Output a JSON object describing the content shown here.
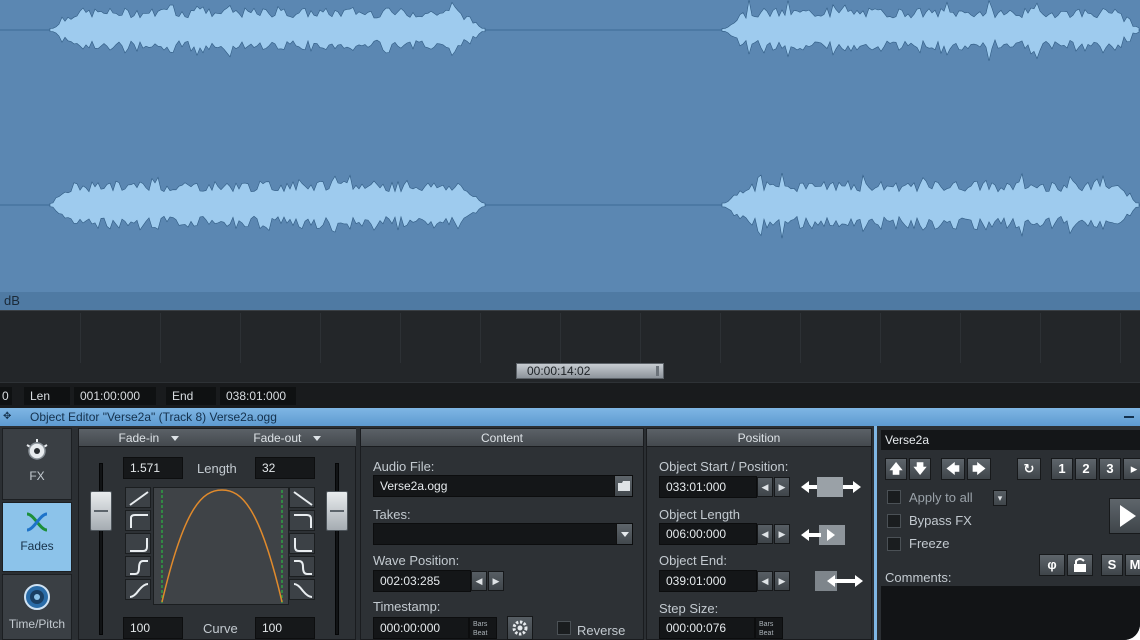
{
  "status": {
    "db_label": "dB",
    "timeline_position": "00:00:14:02"
  },
  "posbar": {
    "partial_value": "0",
    "len_label": "Len",
    "len_value": "001:00:000",
    "end_label": "End",
    "end_value": "038:01:000"
  },
  "object_editor": {
    "title": "Object Editor \"Verse2a\"  (Track 8)  Verse2a.ogg"
  },
  "nav": {
    "fx": "FX",
    "fades": "Fades",
    "time_pitch": "Time/Pitch"
  },
  "fades": {
    "fade_in_label": "Fade-in",
    "fade_out_label": "Fade-out",
    "fade_in_value": "1.571",
    "length_label": "Length",
    "length_value": "32",
    "curve_label": "Curve",
    "curve_in_value": "100",
    "curve_out_value": "100"
  },
  "content": {
    "header": "Content",
    "audio_file_label": "Audio File:",
    "audio_file_value": "Verse2a.ogg",
    "takes_label": "Takes:",
    "takes_value": "",
    "wave_position_label": "Wave Position:",
    "wave_position_value": "002:03:285",
    "timestamp_label": "Timestamp:",
    "timestamp_value": "000:00:000",
    "unit_bars": "Bars",
    "unit_beat": "Beat",
    "reverse_label": "Reverse"
  },
  "position": {
    "header": "Position",
    "start_label": "Object Start / Position:",
    "start_value": "033:01:000",
    "length_label": "Object Length",
    "length_value": "006:00:000",
    "end_label": "Object End:",
    "end_value": "039:01:000",
    "step_label": "Step Size:",
    "step_value": "000:00:076",
    "unit_bars": "Bars",
    "unit_beat": "Beat"
  },
  "right": {
    "object_name": "Verse2a",
    "apply_to_all": "Apply to all",
    "bypass_fx": "Bypass FX",
    "freeze": "Freeze",
    "comments_label": "Comments:",
    "num_buttons": [
      "1",
      "2",
      "3"
    ],
    "solo_label": "S",
    "mute_label": "M"
  },
  "colors": {
    "waveform_fill": "#9ecbee",
    "waveform_bg": "#5b87b2",
    "accent": "#7fb6e4",
    "fade_curve": "#e08a2c"
  }
}
